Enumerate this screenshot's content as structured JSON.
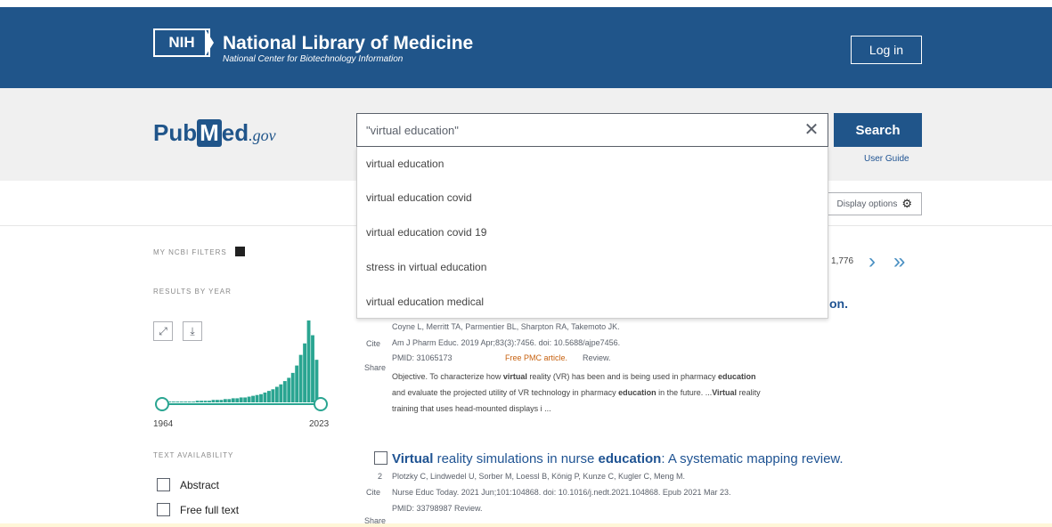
{
  "header": {
    "logo_text": "NIH",
    "title": "National Library of Medicine",
    "subtitle": "National Center for Biotechnology Information",
    "login_label": "Log in",
    "bg_color": "#20558a"
  },
  "search": {
    "logo_pub": "Pub",
    "logo_m": "M",
    "logo_ed": "ed",
    "logo_gov": ".gov",
    "query": "\"virtual education\"",
    "button_label": "Search",
    "user_guide": "User Guide",
    "suggestions": [
      "virtual education",
      "virtual education covid",
      "virtual education covid 19",
      "stress in virtual education",
      "virtual education medical"
    ]
  },
  "display_options_label": "Display options",
  "sidebar": {
    "my_filters_label": "MY NCBI FILTERS",
    "results_by_year_label": "RESULTS BY YEAR",
    "year_start": "1964",
    "year_end": "2023",
    "text_availability_label": "TEXT AVAILABILITY",
    "filters": [
      {
        "label": "Abstract",
        "checked": false
      },
      {
        "label": "Free full text",
        "checked": false
      }
    ]
  },
  "pagination": {
    "count_text": "1,776"
  },
  "results": [
    {
      "title_tail": "on.",
      "authors": "Coyne L, Merritt TA, Parmentier BL, Sharpton RA, Takemoto JK.",
      "citation": "Am J Pharm Educ. 2019 Apr;83(3):7456. doi: 10.5688/ajpe7456.",
      "pmid": "PMID: 31065173",
      "free": "Free PMC article.",
      "type": "Review.",
      "cite": "Cite",
      "share": "Share",
      "snippet_1a": "Objective. To characterize how ",
      "snippet_1b": "virtual",
      "snippet_1c": " reality (VR) has been and is being used in pharmacy ",
      "snippet_1d": "education",
      "snippet_2a": "and evaluate the projected utility of VR technology in pharmacy ",
      "snippet_2b": "education",
      "snippet_2c": " in the future. ...",
      "snippet_2d": "Virtual",
      "snippet_2e": " reality",
      "snippet_3": "training that uses head-mounted displays i ..."
    },
    {
      "number": "2",
      "title_a": "Virtual",
      "title_b": " reality simulations in nurse ",
      "title_c": "education",
      "title_d": ": A systematic mapping review.",
      "authors": "Plotzky C, Lindwedel U, Sorber M, Loessl B, König P, Kunze C, Kugler C, Meng M.",
      "citation": "Nurse Educ Today. 2021 Jun;101:104868. doi: 10.1016/j.nedt.2021.104868. Epub 2021 Mar 23.",
      "pmid": "PMID: 33798987",
      "type": "Review.",
      "cite": "Cite",
      "share": "Share"
    }
  ],
  "chart_data": {
    "type": "bar",
    "title": "",
    "xlabel": "",
    "ylabel": "",
    "x_range": [
      1964,
      2023
    ],
    "trend": "counts near zero from 1964 through early 2000s, rising steeply after ~2010 with a sharp peak around 2021",
    "values_relative": [
      1,
      1,
      1,
      1,
      1,
      1,
      1,
      1,
      2,
      2,
      2,
      2,
      3,
      3,
      3,
      4,
      4,
      5,
      5,
      6,
      6,
      7,
      8,
      9,
      10,
      12,
      14,
      16,
      19,
      22,
      26,
      30,
      36,
      45,
      58,
      72,
      100,
      82,
      52
    ]
  }
}
